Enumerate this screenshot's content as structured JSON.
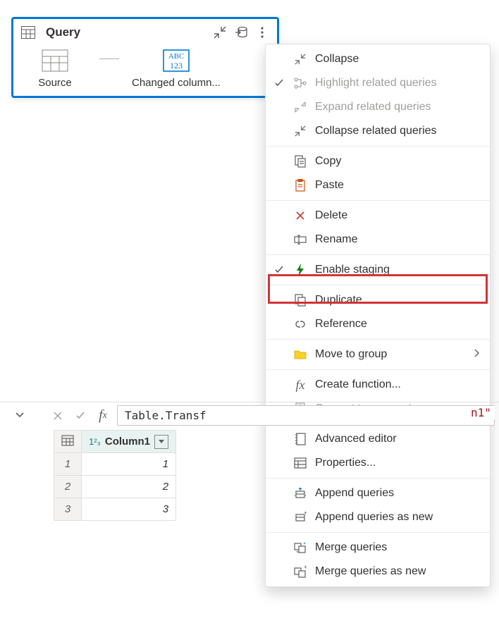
{
  "query_card": {
    "title": "Query",
    "steps": [
      {
        "label": "Source"
      },
      {
        "label": "Changed column..."
      }
    ]
  },
  "menu": {
    "items": [
      {
        "label": "Collapse",
        "check": false,
        "disabled": false,
        "sepAfter": false
      },
      {
        "label": "Highlight related queries",
        "check": true,
        "disabled": true,
        "sepAfter": false
      },
      {
        "label": "Expand related queries",
        "check": false,
        "disabled": true,
        "sepAfter": false
      },
      {
        "label": "Collapse related queries",
        "check": false,
        "disabled": false,
        "sepAfter": true
      },
      {
        "label": "Copy",
        "check": false,
        "disabled": false,
        "sepAfter": false
      },
      {
        "label": "Paste",
        "check": false,
        "disabled": false,
        "sepAfter": true
      },
      {
        "label": "Delete",
        "check": false,
        "disabled": false,
        "sepAfter": false
      },
      {
        "label": "Rename",
        "check": false,
        "disabled": false,
        "sepAfter": true
      },
      {
        "label": "Enable staging",
        "check": true,
        "disabled": false,
        "sepAfter": true
      },
      {
        "label": "Duplicate",
        "check": false,
        "disabled": false,
        "sepAfter": false
      },
      {
        "label": "Reference",
        "check": false,
        "disabled": false,
        "sepAfter": true
      },
      {
        "label": "Move to group",
        "check": false,
        "disabled": false,
        "sepAfter": true,
        "submenu": true
      },
      {
        "label": "Create function...",
        "check": false,
        "disabled": false,
        "sepAfter": false
      },
      {
        "label": "Convert to parameter",
        "check": false,
        "disabled": true,
        "sepAfter": true
      },
      {
        "label": "Advanced editor",
        "check": false,
        "disabled": false,
        "sepAfter": false
      },
      {
        "label": "Properties...",
        "check": false,
        "disabled": false,
        "sepAfter": true
      },
      {
        "label": "Append queries",
        "check": false,
        "disabled": false,
        "sepAfter": false
      },
      {
        "label": "Append queries as new",
        "check": false,
        "disabled": false,
        "sepAfter": true
      },
      {
        "label": "Merge queries",
        "check": false,
        "disabled": false,
        "sepAfter": false
      },
      {
        "label": "Merge queries as new",
        "check": false,
        "disabled": false,
        "sepAfter": false
      }
    ]
  },
  "formula": {
    "text": "Table.Transf",
    "tail": "n1\""
  },
  "grid": {
    "column_type": "1²₃",
    "column_name": "Column1",
    "rows": [
      {
        "n": "1",
        "v": "1"
      },
      {
        "n": "2",
        "v": "2"
      },
      {
        "n": "3",
        "v": "3"
      }
    ]
  }
}
